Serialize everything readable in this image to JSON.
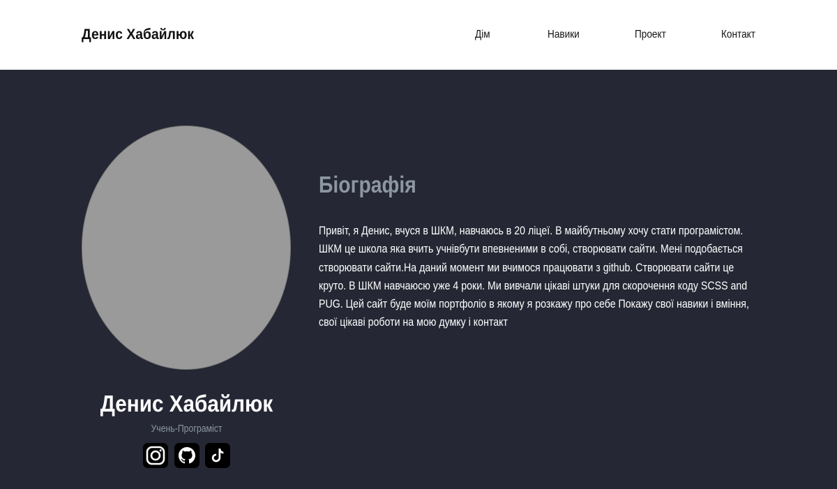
{
  "header": {
    "brand": "Денис Хабайлюк",
    "nav": [
      {
        "label": "Дім"
      },
      {
        "label": "Навики"
      },
      {
        "label": "Проект"
      },
      {
        "label": "Контакт"
      }
    ]
  },
  "profile": {
    "photo_icon": "portrait-photo",
    "name": "Денис Хабайлюк",
    "role": "Учень-Програміст",
    "social": [
      {
        "icon": "instagram-icon"
      },
      {
        "icon": "github-icon"
      },
      {
        "icon": "tiktok-icon"
      }
    ]
  },
  "bio": {
    "title": "Біографія",
    "text": "Привіт, я Денис, вчуся в ШКМ, навчаюсь в 20 ліцеї. В майбутньому хочу стати програмістом. ШКМ це школа яка вчить учнівбути впевненими в собі, створювати сайти. Мені подобається створювати сайти.На даний момент ми вчимося працювати з github. Створювати сайти це круто. В ШКМ навчаюсю уже 4 роки. Ми вивчали цікаві штуки для скорочення коду SCSS and PUG. Цей сайт буде моїм портфоліо в якому я розкажу про себе Покажу свої навики і вміння, свої цікаві роботи на мою думку і контакт"
  },
  "colors": {
    "background": "#252734",
    "header": "#ffffff",
    "accent_muted": "#8c97a2"
  }
}
